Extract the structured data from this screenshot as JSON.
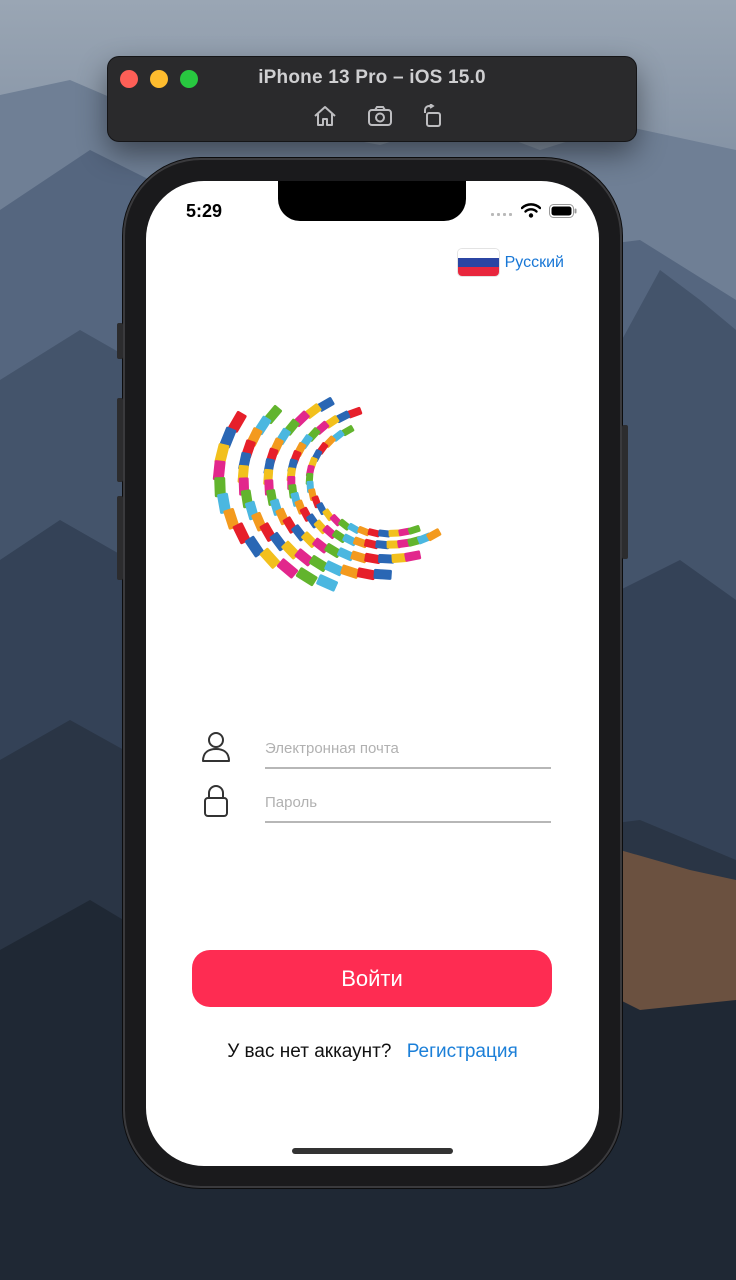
{
  "simulator": {
    "title": "iPhone 13 Pro – iOS 15.0",
    "toolbar_icons": [
      "home-icon",
      "screenshot-icon",
      "rotate-icon"
    ]
  },
  "status_bar": {
    "time": "5:29",
    "icons": [
      "signal-icon",
      "wifi-icon",
      "battery-icon"
    ]
  },
  "language": {
    "label": "Русский",
    "flag_colors": [
      "#ffffff",
      "#2b45a3",
      "#e8263d"
    ]
  },
  "form": {
    "email_placeholder": "Электронная почта",
    "email_value": "",
    "password_placeholder": "Пароль",
    "password_value": "",
    "email_icon": "user-icon",
    "password_icon": "lock-icon"
  },
  "actions": {
    "login_label": "Войти",
    "no_account_text": "У вас нет аккаунт?",
    "register_label": "Регистрация"
  },
  "colors": {
    "accent": "#fe2c52",
    "link": "#1877d6",
    "logo_palette": [
      "#e61f2a",
      "#2a67b4",
      "#f2c01d",
      "#e2278c",
      "#62b42d",
      "#4bb7e0",
      "#f39a1e"
    ]
  }
}
